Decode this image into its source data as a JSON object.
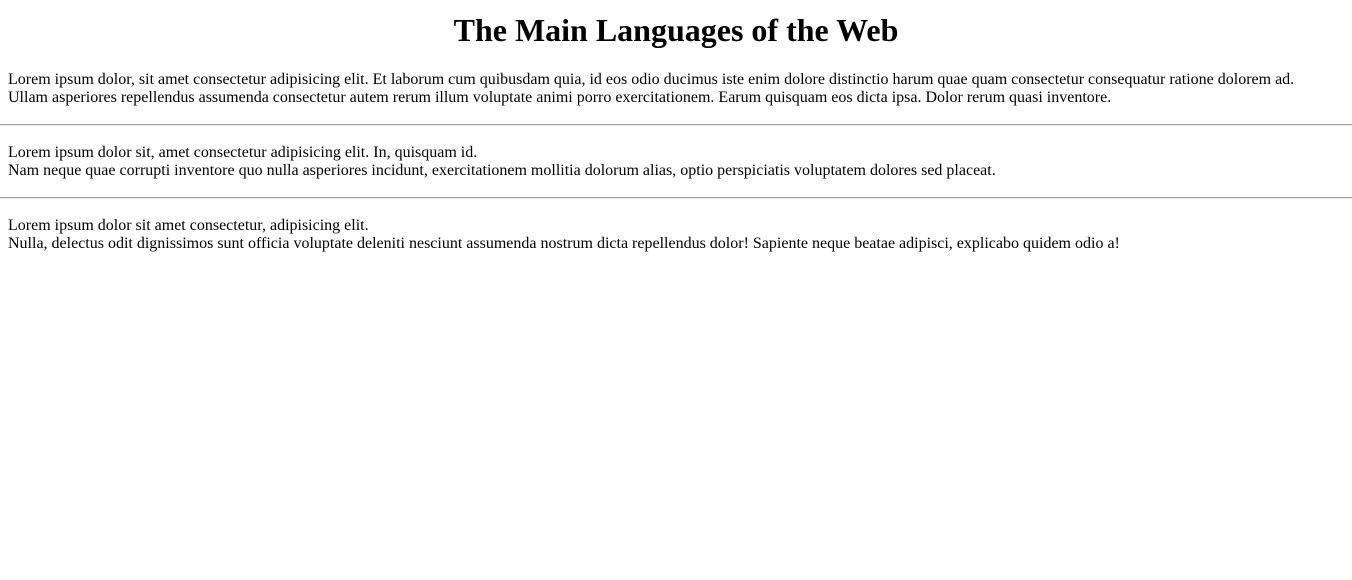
{
  "page": {
    "title": "The Main Languages of the Web"
  },
  "sections": [
    {
      "lines": [
        "Lorem ipsum dolor, sit amet consectetur adipisicing elit. Et laborum cum quibusdam quia, id eos odio ducimus iste enim dolore distinctio harum quae quam consectetur consequatur ratione dolorem ad.",
        "Ullam asperiores repellendus assumenda consectetur autem rerum illum voluptate animi porro exercitationem. Earum quisquam eos dicta ipsa. Dolor rerum quasi inventore."
      ]
    },
    {
      "lines": [
        "Lorem ipsum dolor sit, amet consectetur adipisicing elit. In, quisquam id.",
        "Nam neque quae corrupti inventore quo nulla asperiores incidunt, exercitationem mollitia dolorum alias, optio perspiciatis voluptatem dolores sed placeat."
      ]
    },
    {
      "lines": [
        "Lorem ipsum dolor sit amet consectetur, adipisicing elit.",
        "Nulla, delectus odit dignissimos sunt officia voluptate deleniti nesciunt assumenda nostrum dicta repellendus dolor! Sapiente neque beatae adipisci, explicabo quidem odio a!"
      ]
    }
  ]
}
